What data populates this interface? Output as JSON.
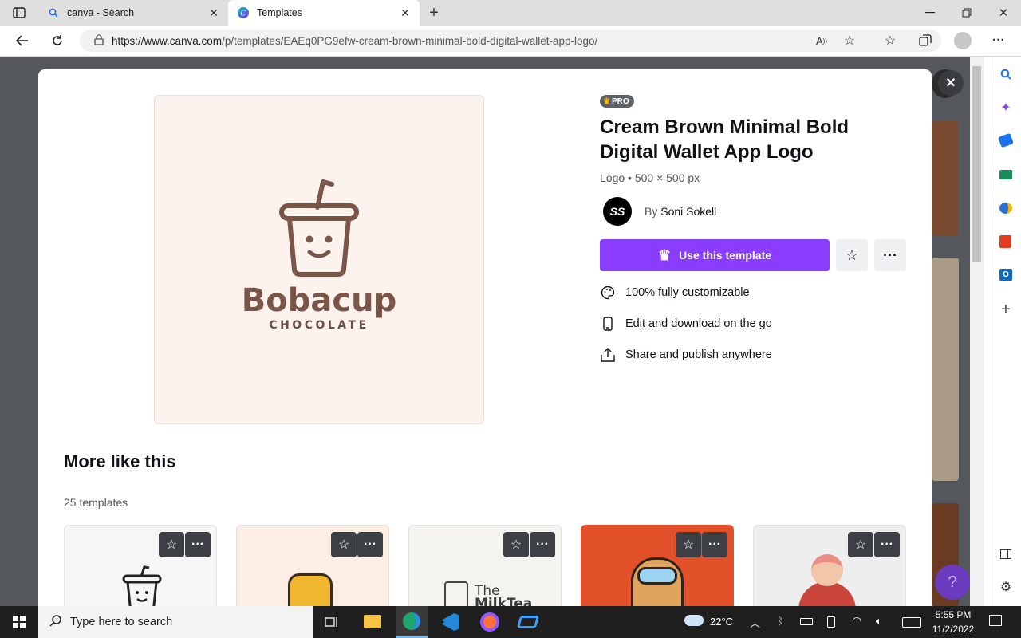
{
  "browser": {
    "tabs": [
      {
        "label": "canva - Search"
      },
      {
        "label": "Templates"
      }
    ],
    "url_prefix": "https://www.canva.com",
    "url_path": "/p/templates/EAEq0PG9efw-cream-brown-minimal-bold-digital-wallet-app-logo/"
  },
  "template": {
    "badge": "PRO",
    "title": "Cream Brown Minimal Bold Digital Wallet App Logo",
    "meta": "Logo • 500 × 500 px",
    "by_prefix": "By",
    "author": "Soni Sokell",
    "author_initials": "SS",
    "use_label": "Use this template",
    "features": [
      {
        "icon": "palette-icon",
        "label": "100% fully customizable"
      },
      {
        "icon": "phone-icon",
        "label": "Edit and download on the go"
      },
      {
        "icon": "share-icon",
        "label": "Share and publish anywhere"
      }
    ],
    "preview": {
      "brand": "Bobacup",
      "sub": "CHOCOLATE",
      "bg": "#fcf3ee",
      "color": "#7a5548"
    }
  },
  "more": {
    "heading": "More like this",
    "count": "25 templates",
    "cards": [
      {
        "bg": "#f6f6f6"
      },
      {
        "bg": "#fdeee4"
      },
      {
        "bg": "#f5f3ee",
        "text1": "The",
        "text2": "MilkTea"
      },
      {
        "bg": "#e2502a"
      },
      {
        "bg": "#eeeeee"
      }
    ]
  },
  "accent": "#8b3dff",
  "taskbar": {
    "search_placeholder": "Type here to search",
    "temperature": "22°C",
    "time": "5:55 PM",
    "date": "11/2/2022"
  }
}
